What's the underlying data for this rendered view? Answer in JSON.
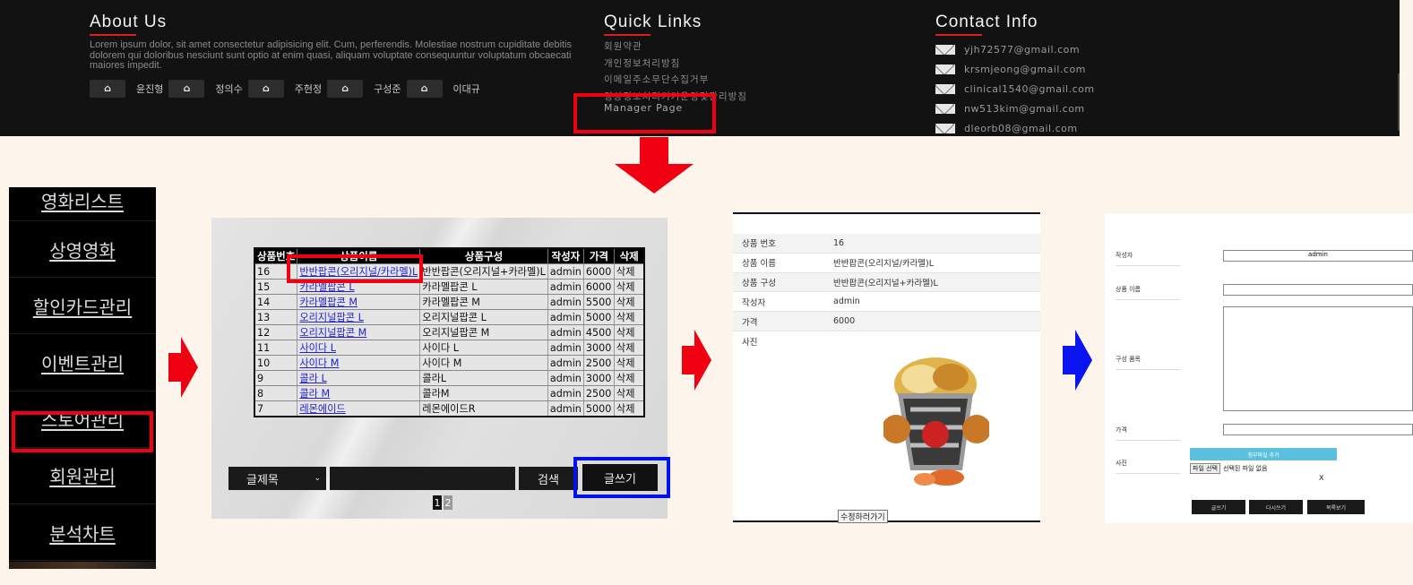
{
  "footer": {
    "about": {
      "title": "About Us",
      "text": "Lorem ipsum dolor, sit amet consectetur adipisicing elit. Cum, perferendis. Molestiae nostrum cupiditate debitis dolorem qui doloribus nesciunt sunt optio at enim quasi, aliquam voluptate consequuntur voluptatum obcaecati maiores impedit.",
      "members": [
        "윤진형",
        "정의수",
        "주현정",
        "구성준",
        "이대규"
      ]
    },
    "quick": {
      "title": "Quick Links",
      "links": [
        "회원약관",
        "개인정보처리방침",
        "이메일주소무단수집거부",
        "영상정보처리기기운영및관리방침"
      ],
      "manager": "Manager Page"
    },
    "contact": {
      "title": "Contact Info",
      "emails": [
        "yjh72577@gmail.com",
        "krsmjeong@gmail.com",
        "clinical1540@gmail.com",
        "nw513kim@gmail.com",
        "dleorb08@gmail.com"
      ]
    }
  },
  "sidebar": {
    "items": [
      "영화리스트",
      "상영영화",
      "할인카드관리",
      "이벤트관리",
      "스토어관리",
      "회원관리",
      "분석차트"
    ]
  },
  "list": {
    "headers": [
      "상품번호",
      "상품이름",
      "상품구성",
      "작성자",
      "가격",
      "삭제"
    ],
    "rows": [
      [
        "16",
        "반반팝콘(오리지널/카라멜)L",
        "반반팝콘(오리지널+카라멜)L",
        "admin",
        "6000",
        "삭제"
      ],
      [
        "15",
        "카라멜팝콘 L",
        "카라멜팝콘 L",
        "admin",
        "6000",
        "삭제"
      ],
      [
        "14",
        "카라멜팝콘 M",
        "카라멜팝콘 M",
        "admin",
        "5500",
        "삭제"
      ],
      [
        "13",
        "오리지널팝콘 L",
        "오리지널팝콘 L",
        "admin",
        "5000",
        "삭제"
      ],
      [
        "12",
        "오리지널팝콘 M",
        "오리지널팝콘 M",
        "admin",
        "4500",
        "삭제"
      ],
      [
        "11",
        "사이다 L",
        "사이다 L",
        "admin",
        "3000",
        "삭제"
      ],
      [
        "10",
        "사이다 M",
        "사이다 M",
        "admin",
        "2500",
        "삭제"
      ],
      [
        "9",
        "콜라 L",
        "콜라L",
        "admin",
        "3000",
        "삭제"
      ],
      [
        "8",
        "콜라 M",
        "콜라M",
        "admin",
        "2500",
        "삭제"
      ],
      [
        "7",
        "레몬에이드",
        "레몬에이드R",
        "admin",
        "5000",
        "삭제"
      ]
    ],
    "search_select": "글제목",
    "search_button": "검색",
    "write_button": "글쓰기",
    "pages": [
      "1",
      "2"
    ]
  },
  "detail": {
    "rows": [
      [
        "상품 번호",
        "16"
      ],
      [
        "상품 이름",
        "반반팝콘(오리지널/카라멜)L"
      ],
      [
        "상품 구성",
        "반반팝콘(오리지널+카라멜)L"
      ],
      [
        "작성자",
        "admin"
      ],
      [
        "가격",
        "6000"
      ],
      [
        "사진",
        ""
      ]
    ],
    "edit_button": "수정하러가기"
  },
  "form": {
    "labels": [
      "작성자",
      "상품 이름",
      "구성 품목",
      "가격",
      "사진"
    ],
    "writer_value": "admin",
    "attach_button": "첨부파일 추가",
    "file_button": "파일 선택",
    "file_status": "선택된 파일 없음",
    "x_mark": "X",
    "buttons": [
      "글쓰기",
      "다시쓰기",
      "목록보기"
    ]
  },
  "colors": {
    "highlight_red": "#f00010",
    "highlight_blue": "#0010ee",
    "arrow_red": "#f00010",
    "arrow_blue": "#0a14f0"
  }
}
